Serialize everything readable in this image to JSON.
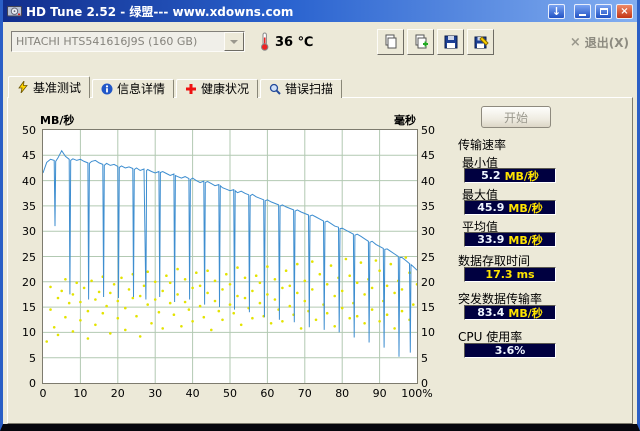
{
  "window": {
    "title": "HD Tune 2.52 - 绿盟--- www.xdowns.com",
    "download_glyph": "↓",
    "close_glyph": "×"
  },
  "toolbar": {
    "drive_select": "HITACHI HTS541616J9S (160 GB)",
    "temperature": "36 ℃",
    "exit_icon_glyph": "×",
    "exit_label": "退出(X)"
  },
  "tabs": [
    {
      "label": "基准测试"
    },
    {
      "label": "信息详情"
    },
    {
      "label": "健康状况"
    },
    {
      "label": "错误扫描"
    }
  ],
  "benchmark": {
    "start_label": "开始",
    "stats": {
      "group_label": "传输速率",
      "min_label": "最小值",
      "min_value": "5.2",
      "min_unit": "MB/秒",
      "max_label": "最大值",
      "max_value": "45.9",
      "max_unit": "MB/秒",
      "avg_label": "平均值",
      "avg_value": "33.9",
      "avg_unit": "MB/秒",
      "access_label": "数据存取时间",
      "access_value": "17.3",
      "access_unit": "ms",
      "burst_label": "突发数据传输率",
      "burst_value": "83.4",
      "burst_unit": "MB/秒",
      "cpu_label": "CPU 使用率",
      "cpu_value": "3.6%"
    }
  },
  "chart_data": {
    "type": "line+scatter",
    "left_axis_label": "MB/秒",
    "right_axis_label": "毫秒",
    "xlim": [
      0,
      100
    ],
    "ylim": [
      0,
      50
    ],
    "x_ticks": [
      "0",
      "10",
      "20",
      "30",
      "40",
      "50",
      "60",
      "70",
      "80",
      "90",
      "100%"
    ],
    "y_ticks": [
      50,
      45,
      40,
      35,
      30,
      25,
      20,
      15,
      10,
      5,
      0
    ],
    "grid": true,
    "grid_color": "#b2c9b2",
    "plot_bg": "#ffffff",
    "series": [
      {
        "name": "transfer_rate",
        "unit": "MB/秒",
        "type": "line",
        "color": "#3e8ed0",
        "points": [
          [
            0,
            41.5
          ],
          [
            1,
            43.6
          ],
          [
            2,
            44.2
          ],
          [
            3,
            44
          ],
          [
            3.2,
            31
          ],
          [
            3.4,
            43.8
          ],
          [
            4,
            44.5
          ],
          [
            5,
            45.9
          ],
          [
            6,
            44.8
          ],
          [
            7,
            44.2
          ],
          [
            7.2,
            17.5
          ],
          [
            7.4,
            44
          ],
          [
            8,
            44.3
          ],
          [
            9,
            44
          ],
          [
            10,
            44.2
          ],
          [
            11,
            43.8
          ],
          [
            12,
            43.5
          ],
          [
            12.2,
            16.5
          ],
          [
            12.4,
            43.4
          ],
          [
            13,
            43.8
          ],
          [
            14,
            44
          ],
          [
            15,
            43.5
          ],
          [
            16,
            43.2
          ],
          [
            16.2,
            17
          ],
          [
            16.4,
            43
          ],
          [
            17,
            43.4
          ],
          [
            18,
            43
          ],
          [
            19,
            43.2
          ],
          [
            20,
            42.8
          ],
          [
            20.2,
            16.8
          ],
          [
            20.4,
            42.6
          ],
          [
            21,
            42.9
          ],
          [
            22,
            42.5
          ],
          [
            23,
            42.7
          ],
          [
            24,
            42.4
          ],
          [
            24.2,
            17
          ],
          [
            24.4,
            42.2
          ],
          [
            25,
            42.5
          ],
          [
            26,
            42
          ],
          [
            27,
            42.3
          ],
          [
            27.5,
            16.5
          ],
          [
            27.7,
            42
          ],
          [
            28,
            42.2
          ],
          [
            29,
            41.8
          ],
          [
            30,
            41.5
          ],
          [
            31,
            41.8
          ],
          [
            31.2,
            17
          ],
          [
            31.4,
            41.6
          ],
          [
            32,
            41.8
          ],
          [
            33,
            41.4
          ],
          [
            34,
            41
          ],
          [
            35,
            41.3
          ],
          [
            35.2,
            16
          ],
          [
            35.4,
            41
          ],
          [
            36,
            40.8
          ],
          [
            37,
            40.5
          ],
          [
            38,
            40.8
          ],
          [
            39,
            40.4
          ],
          [
            39.2,
            16.5
          ],
          [
            39.4,
            40.2
          ],
          [
            40,
            40.5
          ],
          [
            41,
            40
          ],
          [
            42,
            39.6
          ],
          [
            43,
            39.9
          ],
          [
            43.2,
            15.5
          ],
          [
            43.4,
            39.6
          ],
          [
            44,
            39.8
          ],
          [
            45,
            39.4
          ],
          [
            46,
            39
          ],
          [
            47,
            39.2
          ],
          [
            47.2,
            15
          ],
          [
            47.4,
            39
          ],
          [
            48,
            38.6
          ],
          [
            49,
            38.3
          ],
          [
            50,
            38
          ],
          [
            51,
            38.2
          ],
          [
            51.2,
            14.5
          ],
          [
            51.4,
            38
          ],
          [
            52,
            37.6
          ],
          [
            53,
            37.9
          ],
          [
            54,
            37.5
          ],
          [
            55,
            37.2
          ],
          [
            55.2,
            14
          ],
          [
            55.4,
            37
          ],
          [
            56,
            37.3
          ],
          [
            57,
            36.8
          ],
          [
            58,
            36.5
          ],
          [
            59,
            36.2
          ],
          [
            59.2,
            13
          ],
          [
            59.4,
            36
          ],
          [
            60,
            36.2
          ],
          [
            61,
            35.8
          ],
          [
            62,
            35.5
          ],
          [
            63,
            35.2
          ],
          [
            63.2,
            12.5
          ],
          [
            63.4,
            35
          ],
          [
            64,
            35.2
          ],
          [
            65,
            34.8
          ],
          [
            66,
            34.5
          ],
          [
            67,
            34.2
          ],
          [
            67.2,
            12
          ],
          [
            67.4,
            34
          ],
          [
            68,
            34.2
          ],
          [
            69,
            33.8
          ],
          [
            70,
            33.5
          ],
          [
            71,
            33.2
          ],
          [
            71.2,
            11
          ],
          [
            71.4,
            33
          ],
          [
            72,
            33.2
          ],
          [
            73,
            32.8
          ],
          [
            74,
            32.4
          ],
          [
            75,
            32
          ],
          [
            75.2,
            10.5
          ],
          [
            75.4,
            31.8
          ],
          [
            76,
            32
          ],
          [
            77,
            31.5
          ],
          [
            78,
            31
          ],
          [
            79,
            30.8
          ],
          [
            79.2,
            10
          ],
          [
            79.4,
            30.5
          ],
          [
            80,
            30.6
          ],
          [
            81,
            30.2
          ],
          [
            82,
            29.8
          ],
          [
            83,
            29.4
          ],
          [
            83.2,
            9
          ],
          [
            83.4,
            29.2
          ],
          [
            84,
            29.4
          ],
          [
            85,
            29
          ],
          [
            86,
            28.5
          ],
          [
            87,
            28
          ],
          [
            87.2,
            8
          ],
          [
            87.4,
            27.8
          ],
          [
            88,
            28
          ],
          [
            89,
            27.4
          ],
          [
            90,
            27
          ],
          [
            91,
            26.6
          ],
          [
            91.2,
            7
          ],
          [
            91.4,
            26.4
          ],
          [
            92,
            26.5
          ],
          [
            93,
            26
          ],
          [
            94,
            25.5
          ],
          [
            95,
            25
          ],
          [
            95.2,
            5.2
          ],
          [
            95.4,
            24.8
          ],
          [
            96,
            24.8
          ],
          [
            97,
            24.2
          ],
          [
            98,
            23.6
          ],
          [
            98.2,
            6
          ],
          [
            98.4,
            23.4
          ],
          [
            99,
            23
          ],
          [
            100,
            22.3
          ]
        ]
      },
      {
        "name": "access_time",
        "unit": "ms",
        "type": "scatter",
        "color": "#e3e300",
        "points": [
          [
            1,
            8.2
          ],
          [
            2,
            14.5
          ],
          [
            2,
            19
          ],
          [
            3,
            11
          ],
          [
            4,
            16.8
          ],
          [
            4,
            9.5
          ],
          [
            5,
            18.2
          ],
          [
            6,
            13
          ],
          [
            6,
            20.5
          ],
          [
            7,
            15.8
          ],
          [
            8,
            10.2
          ],
          [
            8,
            17.5
          ],
          [
            9,
            19.8
          ],
          [
            10,
            12.4
          ],
          [
            10,
            16
          ],
          [
            11,
            18.8
          ],
          [
            12,
            14.2
          ],
          [
            12,
            8.8
          ],
          [
            13,
            20.2
          ],
          [
            14,
            16.5
          ],
          [
            14,
            11.5
          ],
          [
            15,
            18
          ],
          [
            16,
            13.8
          ],
          [
            16,
            21
          ],
          [
            17,
            15.2
          ],
          [
            18,
            9.8
          ],
          [
            18,
            17.8
          ],
          [
            19,
            19.5
          ],
          [
            20,
            12.8
          ],
          [
            20,
            16.2
          ],
          [
            21,
            20.8
          ],
          [
            22,
            14.8
          ],
          [
            22,
            10.5
          ],
          [
            23,
            18.5
          ],
          [
            24,
            16.8
          ],
          [
            24,
            21.5
          ],
          [
            25,
            13.2
          ],
          [
            26,
            17.2
          ],
          [
            26,
            9.2
          ],
          [
            27,
            19.2
          ],
          [
            28,
            15.5
          ],
          [
            28,
            22
          ],
          [
            29,
            11.8
          ],
          [
            30,
            16.5
          ],
          [
            30,
            20
          ],
          [
            31,
            14
          ],
          [
            32,
            18.2
          ],
          [
            32,
            10.8
          ],
          [
            33,
            21.2
          ],
          [
            34,
            15.8
          ],
          [
            34,
            19.8
          ],
          [
            35,
            13.5
          ],
          [
            36,
            17.5
          ],
          [
            36,
            22.5
          ],
          [
            37,
            11.2
          ],
          [
            38,
            16
          ],
          [
            38,
            20.5
          ],
          [
            39,
            14.5
          ],
          [
            40,
            18.8
          ],
          [
            40,
            12.2
          ],
          [
            41,
            21.8
          ],
          [
            42,
            15.2
          ],
          [
            42,
            19.2
          ],
          [
            43,
            13
          ],
          [
            44,
            17.8
          ],
          [
            44,
            22.2
          ],
          [
            45,
            10.5
          ],
          [
            46,
            16.2
          ],
          [
            46,
            20.2
          ],
          [
            47,
            14.2
          ],
          [
            48,
            18.5
          ],
          [
            48,
            12.5
          ],
          [
            49,
            21.5
          ],
          [
            50,
            15.5
          ],
          [
            50,
            19.5
          ],
          [
            51,
            13.8
          ],
          [
            52,
            17.2
          ],
          [
            52,
            22.8
          ],
          [
            53,
            11.5
          ],
          [
            54,
            16.8
          ],
          [
            54,
            20.8
          ],
          [
            55,
            14.8
          ],
          [
            56,
            18.2
          ],
          [
            56,
            12.8
          ],
          [
            57,
            21.2
          ],
          [
            58,
            15.8
          ],
          [
            58,
            19.8
          ],
          [
            59,
            13.2
          ],
          [
            60,
            17.5
          ],
          [
            60,
            23
          ],
          [
            61,
            11.8
          ],
          [
            62,
            16.5
          ],
          [
            62,
            20.5
          ],
          [
            63,
            14.5
          ],
          [
            64,
            18.8
          ],
          [
            64,
            12.2
          ],
          [
            65,
            22.2
          ],
          [
            66,
            15.2
          ],
          [
            66,
            19.2
          ],
          [
            67,
            13.5
          ],
          [
            68,
            17.8
          ],
          [
            68,
            23.5
          ],
          [
            69,
            10.8
          ],
          [
            70,
            16.2
          ],
          [
            70,
            20.2
          ],
          [
            71,
            14.2
          ],
          [
            72,
            18.5
          ],
          [
            72,
            24
          ],
          [
            73,
            12.5
          ],
          [
            74,
            21.5
          ],
          [
            75,
            15.5
          ],
          [
            76,
            19.5
          ],
          [
            76,
            13.8
          ],
          [
            77,
            23.2
          ],
          [
            78,
            17.2
          ],
          [
            78,
            11.2
          ],
          [
            79,
            20.8
          ],
          [
            80,
            14.8
          ],
          [
            80,
            18.2
          ],
          [
            81,
            24.5
          ],
          [
            82,
            12.8
          ],
          [
            82,
            21.2
          ],
          [
            83,
            15.8
          ],
          [
            84,
            19.8
          ],
          [
            84,
            13.2
          ],
          [
            85,
            23.8
          ],
          [
            86,
            17.5
          ],
          [
            86,
            11.8
          ],
          [
            87,
            20.5
          ],
          [
            88,
            14.5
          ],
          [
            88,
            18.8
          ],
          [
            89,
            24.2
          ],
          [
            90,
            12.2
          ],
          [
            90,
            22.2
          ],
          [
            91,
            16.2
          ],
          [
            92,
            19.2
          ],
          [
            92,
            13.5
          ],
          [
            93,
            23.5
          ],
          [
            94,
            17.8
          ],
          [
            94,
            10.8
          ],
          [
            95,
            20.2
          ],
          [
            96,
            14.2
          ],
          [
            96,
            18.5
          ],
          [
            97,
            24.8
          ],
          [
            98,
            12.5
          ],
          [
            98,
            21.8
          ],
          [
            99,
            15.5
          ],
          [
            100,
            19.5
          ]
        ]
      }
    ]
  }
}
